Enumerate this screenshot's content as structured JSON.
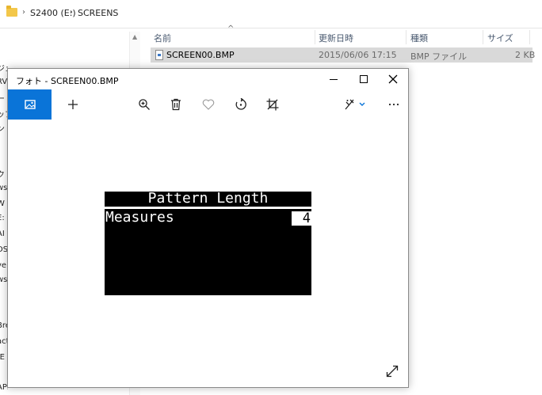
{
  "explorer": {
    "breadcrumb": [
      "S2400 (E:)",
      "SCREENS"
    ],
    "columns": [
      "名前",
      "更新日時",
      "種類",
      "サイズ"
    ],
    "file": {
      "name": "SCREEN00.BMP",
      "modified": "2015/06/06 17:15",
      "type": "BMP ファイル",
      "size": "2 KB"
    },
    "nav_fragments": [
      "ジェクト",
      "RV",
      "ード",
      "ップ",
      "ント",
      "ク",
      "ws",
      "W",
      "E:",
      "AI",
      "DS",
      "ve",
      "ws",
      ")",
      "Bre",
      "act",
      "-E",
      "APS"
    ]
  },
  "photos": {
    "title": "フォト - SCREEN00.BMP",
    "toolbar": [
      "photo-view-icon",
      "add-icon",
      "zoom-icon",
      "delete-icon",
      "favorite-icon",
      "rotate-icon",
      "crop-icon",
      "edit-icon",
      "more-icon"
    ],
    "screen": {
      "title": "Pattern Length",
      "label": "Measures",
      "value": "4"
    }
  },
  "colors": {
    "accent": "#0a74d8",
    "selection": "#d9d9d9",
    "folder": "#f3c74a"
  }
}
